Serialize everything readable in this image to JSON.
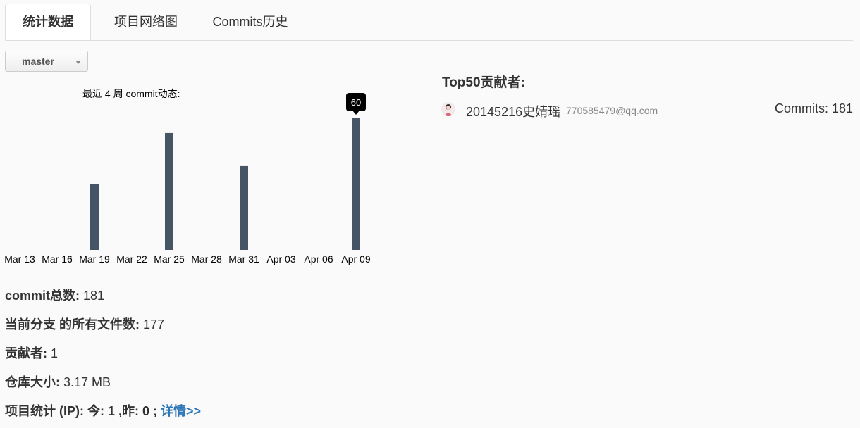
{
  "tabs": [
    {
      "label": "统计数据",
      "active": true
    },
    {
      "label": "项目网络图",
      "active": false
    },
    {
      "label": "Commits历史",
      "active": false
    }
  ],
  "branch": {
    "selected": "master"
  },
  "chart_data": {
    "type": "bar",
    "title": "最近 4 周 commit动态:",
    "categories": [
      "Mar 13",
      "Mar 16",
      "Mar 19",
      "Mar 22",
      "Mar 25",
      "Mar 28",
      "Mar 31",
      "Apr 03",
      "Apr 06",
      "Apr 09"
    ],
    "values": [
      0,
      0,
      30,
      0,
      53,
      0,
      38,
      0,
      0,
      60
    ],
    "tooltip": {
      "category": "Apr 09",
      "label": "60"
    },
    "bar_color": "#465566",
    "ylim": [
      0,
      60
    ],
    "grid": false,
    "legend": "none"
  },
  "stats": {
    "commit_total_label": "commit总数:",
    "commit_total_value": "181",
    "files_label": "当前分支 的所有文件数:",
    "files_value": "177",
    "contributors_label": "贡献者:",
    "contributors_value": "1",
    "repo_size_label": "仓库大小:",
    "repo_size_value": "3.17 MB",
    "project_stats_label": "项目统计 (IP): 今: 1 ,昨: 0 ;",
    "detail_link": "详情>>"
  },
  "top_contributors": {
    "title": "Top50贡献者:",
    "items": [
      {
        "name": "20145216史婧瑶",
        "email": "770585479@qq.com",
        "commits": "Commits: 181",
        "avatar": "user-avatar-icon"
      }
    ]
  }
}
